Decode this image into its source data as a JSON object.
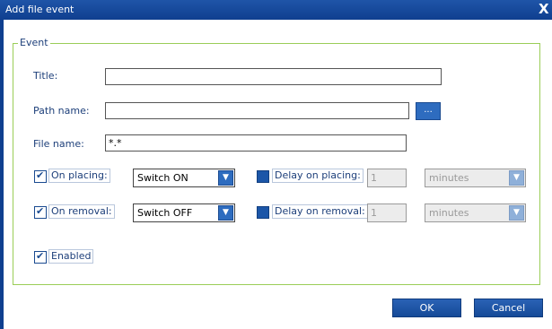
{
  "window": {
    "title": "Add file event",
    "close_glyph": "X"
  },
  "group": {
    "legend": "Event"
  },
  "fields": {
    "title": {
      "label": "Title:",
      "value": ""
    },
    "path": {
      "label": "Path name:",
      "value": "",
      "browse_label": "..."
    },
    "file": {
      "label": "File name:",
      "value": "*.*"
    }
  },
  "placing": {
    "checkbox_label": "On placing:",
    "checked": true,
    "action": "Switch ON",
    "delay_label": "Delay on placing:",
    "delay_value": "1",
    "unit": "minutes"
  },
  "removal": {
    "checkbox_label": "On removal:",
    "checked": true,
    "action": "Switch OFF",
    "delay_label": "Delay on removal:",
    "delay_value": "1",
    "unit": "minutes"
  },
  "enabled": {
    "label": "Enabled",
    "checked": true
  },
  "buttons": {
    "ok": "OK",
    "cancel": "Cancel"
  },
  "colors": {
    "titlebar": "#0f3f8f",
    "group_border": "#9acd57",
    "accent": "#2e6cbf",
    "label": "#1d3f7a"
  }
}
